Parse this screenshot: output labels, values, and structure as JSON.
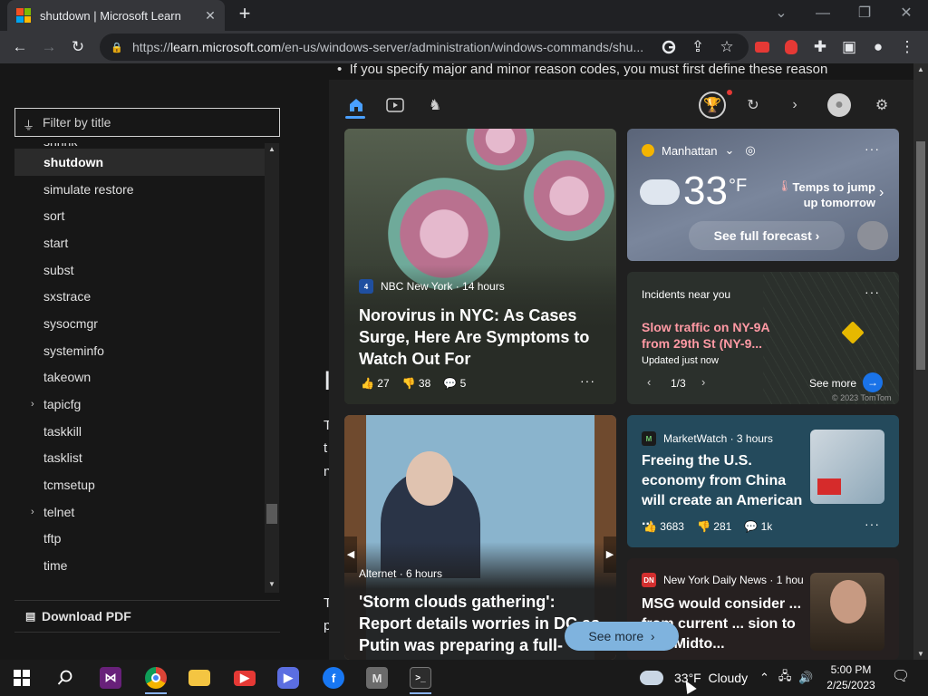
{
  "browser": {
    "tab_title": "shutdown | Microsoft Learn",
    "new_tab": "+",
    "url_domain": "learn.microsoft.com",
    "url_path": "/en-us/windows-server/administration/windows-commands/shu...",
    "url_prefix": "https://"
  },
  "article": {
    "bullet_text": "If you specify major and minor reason codes, you must first define these reason",
    "partial_letters": [
      "I",
      "T",
      "t",
      "n",
      "T",
      "p"
    ]
  },
  "sidebar": {
    "filter_placeholder": "Filter by title",
    "partial_top": "shrink",
    "items": [
      {
        "label": "shutdown",
        "selected": true
      },
      {
        "label": "simulate restore"
      },
      {
        "label": "sort"
      },
      {
        "label": "start"
      },
      {
        "label": "subst"
      },
      {
        "label": "sxstrace"
      },
      {
        "label": "sysocmgr"
      },
      {
        "label": "systeminfo"
      },
      {
        "label": "takeown"
      },
      {
        "label": "tapicfg",
        "expandable": true
      },
      {
        "label": "taskkill"
      },
      {
        "label": "tasklist"
      },
      {
        "label": "tcmsetup"
      },
      {
        "label": "telnet",
        "expandable": true
      },
      {
        "label": "tftp"
      },
      {
        "label": "time"
      }
    ],
    "download_pdf": "Download PDF"
  },
  "widgets": {
    "header_icons": [
      "home-icon",
      "video-icon",
      "game-icon",
      "rewards-icon",
      "refresh-icon",
      "forward-icon",
      "profile-icon",
      "settings-icon"
    ],
    "news1": {
      "source": "NBC New York · 14 hours",
      "headline": "Norovirus in NYC: As Cases Surge, Here Are Symptoms to Watch Out For",
      "likes": "27",
      "dislikes": "38",
      "comments": "5"
    },
    "weather": {
      "location": "Manhattan",
      "temp": "33",
      "unit": "°F",
      "note": "Temps to jump up tomorrow",
      "forecast_button": "See full forecast"
    },
    "traffic": {
      "title": "Incidents near you",
      "incident": "Slow traffic on NY-9A from 29th St (NY-9...",
      "updated": "Updated just now",
      "pager": "1/3",
      "see_more": "See more",
      "copyright": "© 2023 TomTom"
    },
    "news2": {
      "source": "Alternet · 6 hours",
      "headline": "'Storm clouds gathering': Report details worries in DC as Putin was preparing a full-fledged ..."
    },
    "news3": {
      "source": "MarketWatch · 3 hours",
      "headline": "Freeing the U.S. economy from China will create an American ...",
      "likes": "3683",
      "dislikes": "281",
      "comments": "1k"
    },
    "news4": {
      "source": "New York Daily News · 1 hou",
      "headline": "MSG would consider ... from current ... sion to new Midto..."
    },
    "see_more_button": "See more"
  },
  "taskbar": {
    "weather_temp": "33°F",
    "weather_text": "Cloudy",
    "time": "5:00 PM",
    "date": "2/25/2023"
  },
  "colors": {
    "accent": "#8ab4f8",
    "traffic_red": "#ff99a4",
    "widget_home_blue": "#4aa0ff"
  }
}
